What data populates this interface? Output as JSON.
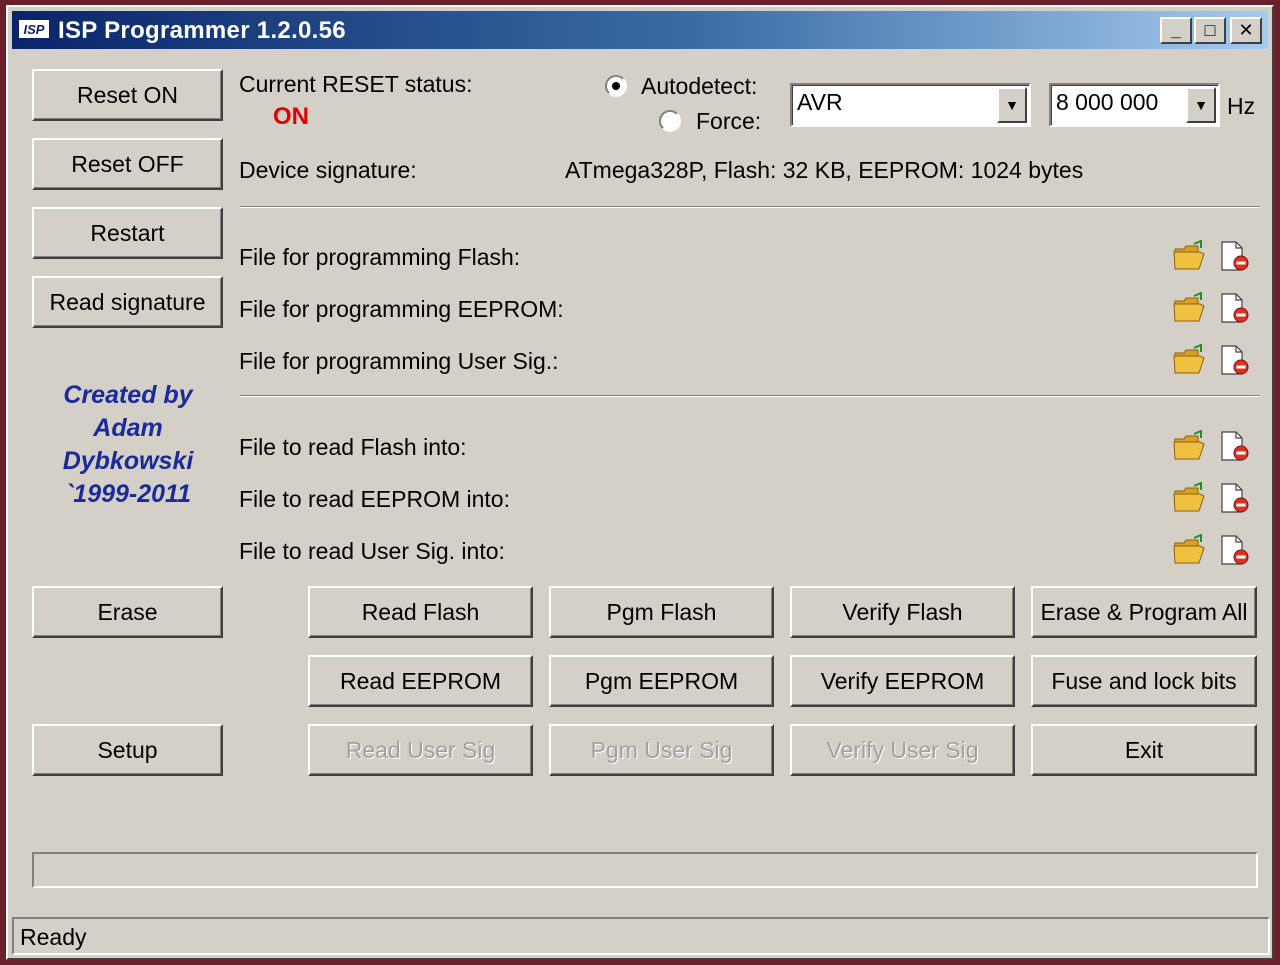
{
  "window": {
    "title": "ISP Programmer 1.2.0.56",
    "logo_text": "ISP"
  },
  "title_buttons": {
    "minimize": "_",
    "maximize": "□",
    "close": "✕"
  },
  "left_buttons": {
    "reset_on": "Reset ON",
    "reset_off": "Reset OFF",
    "restart": "Restart",
    "read_signature": "Read signature",
    "erase": "Erase",
    "setup": "Setup"
  },
  "reset_status": {
    "label": "Current RESET status:",
    "value": "ON"
  },
  "detect": {
    "autodetect_label": "Autodetect:",
    "force_label": "Force:",
    "selected": "autodetect",
    "device_family": "AVR",
    "frequency": "8 000 000",
    "frequency_unit": "Hz"
  },
  "signature": {
    "label": "Device signature:",
    "value": "ATmega328P, Flash: 32 KB, EEPROM: 1024 bytes"
  },
  "program_files": {
    "flash": "File for programming Flash:",
    "eeprom": "File for programming EEPROM:",
    "user_sig": "File for programming User Sig.:"
  },
  "read_files": {
    "flash": "File to read Flash into:",
    "eeprom": "File to read EEPROM into:",
    "user_sig": "File to read User Sig. into:"
  },
  "credits": {
    "line1": "Created by",
    "line2": "Adam",
    "line3": "Dybkowski",
    "line4": "`1999-2011"
  },
  "actions": {
    "read_flash": "Read Flash",
    "pgm_flash": "Pgm Flash",
    "verify_flash": "Verify Flash",
    "erase_program_all": "Erase & Program All",
    "read_eeprom": "Read EEPROM",
    "pgm_eeprom": "Pgm EEPROM",
    "verify_eeprom": "Verify EEPROM",
    "fuse_lock_bits": "Fuse and lock bits",
    "read_user_sig": "Read User Sig",
    "pgm_user_sig": "Pgm User Sig",
    "verify_user_sig": "Verify User Sig",
    "exit": "Exit"
  },
  "progress": {
    "percent": 0
  },
  "status": {
    "text": "Ready"
  },
  "colors": {
    "status_on": "#e00000",
    "credits": "#1a2a9a",
    "titlebar_start": "#0a246a",
    "titlebar_end": "#a6caf0",
    "face": "#d4d0c8",
    "folder": "#f0c040",
    "doc_badge": "#e03020"
  },
  "icons": {
    "open": "folder-open-icon",
    "clear": "document-delete-icon"
  }
}
